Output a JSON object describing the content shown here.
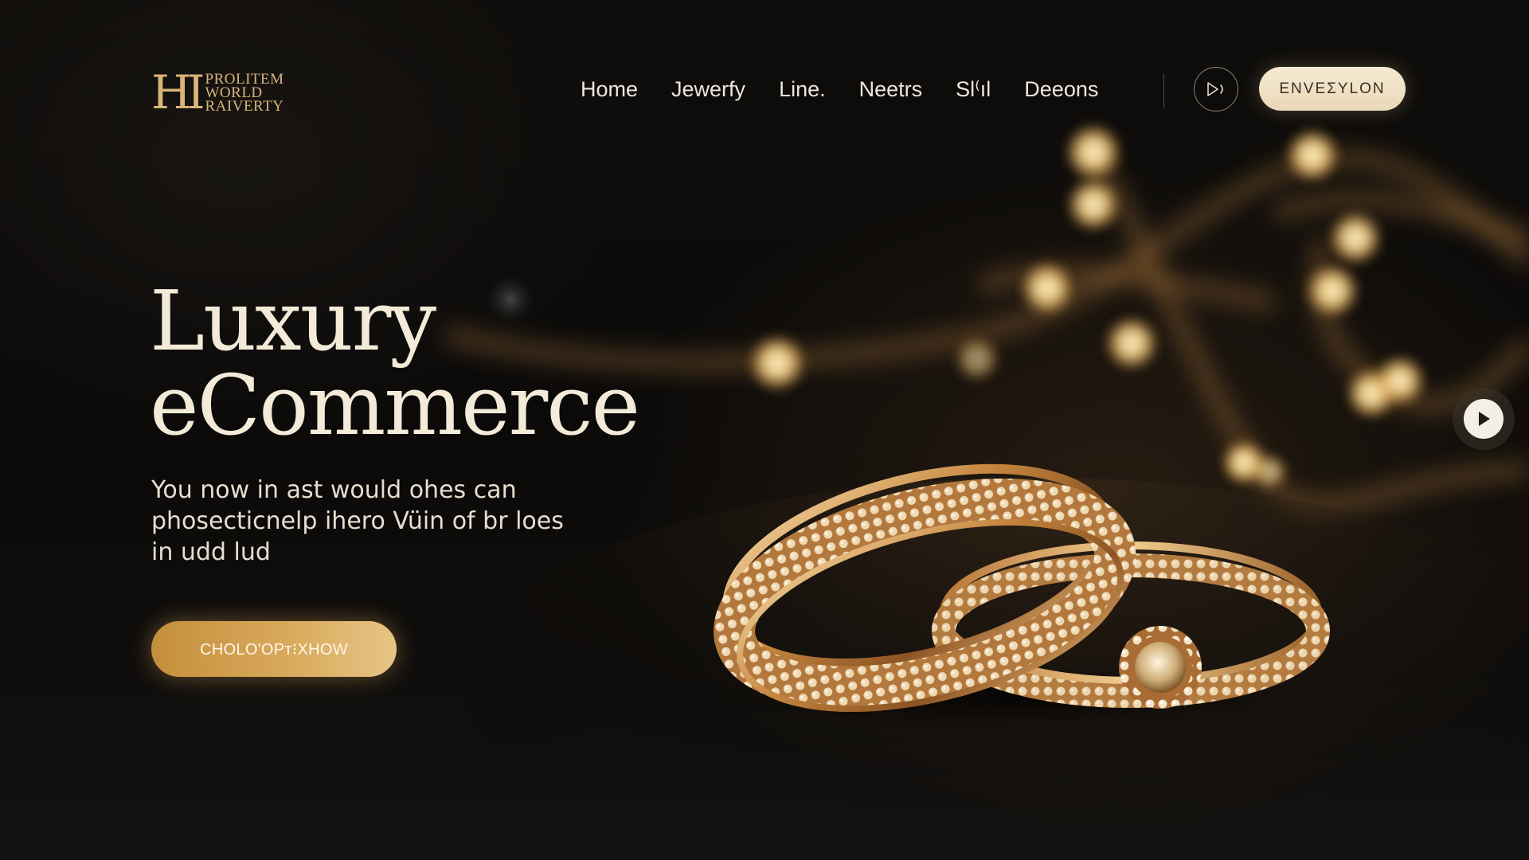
{
  "brand": {
    "mark": "HI",
    "lines": [
      "PROLITEM",
      "WORLD",
      "RAIVERTY"
    ]
  },
  "nav": {
    "items": [
      "Home",
      "Jewerfy",
      "Line.",
      "Neetrs",
      "Sl⁽ıl",
      "Deeons"
    ]
  },
  "header": {
    "cta_label": "ENVEΣYLON"
  },
  "hero": {
    "title_line1": "Luxury",
    "title_line2": "eCommerce",
    "subtitle_lines": [
      "You now in ast would ohes can",
      "phosecticnelp ihero Vüin of br loes",
      "in udd lud"
    ],
    "cta_label": "CHOLO'OPᴛ⁝XHOW"
  },
  "icons": {
    "header_play": "play-outline-icon",
    "side_play": "play-icon"
  },
  "colors": {
    "gold": "#d9b47a",
    "cream": "#f4ead8",
    "background": "#0b0a09",
    "cta_gold": "#d8a95b"
  }
}
